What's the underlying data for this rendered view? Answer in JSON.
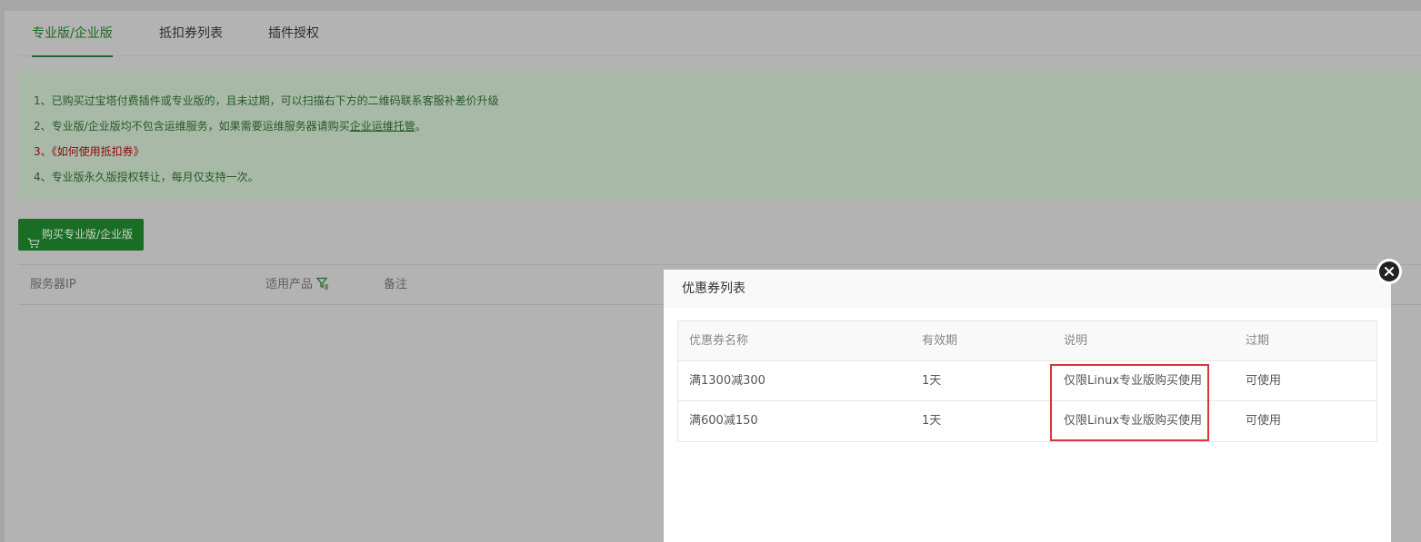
{
  "tabs": [
    {
      "label": "专业版/企业版",
      "active": true
    },
    {
      "label": "抵扣券列表",
      "active": false
    },
    {
      "label": "插件授权",
      "active": false
    }
  ],
  "notice": {
    "line1": "1、已购买过宝塔付费插件或专业版的，且未过期，可以扫描右下方的二维码联系客服补差价升级",
    "line2_prefix": "2、专业版/企业版均不包含运维服务，如果需要运维服务器请购买",
    "line2_link": "企业运维托管",
    "line2_suffix": "。",
    "line3": "3、《如何使用抵扣券》",
    "line4": "4、专业版永久版授权转让，每月仅支持一次。"
  },
  "buy_button": {
    "label": "购买专业版/企业版",
    "icon": "cart-icon"
  },
  "server_table": {
    "headers": [
      "服务器IP",
      "适用产品",
      "备注"
    ],
    "filter_icon": "filter-icon"
  },
  "dialog": {
    "title": "优惠券列表",
    "close_icon": "close-icon",
    "headers": [
      "优惠券名称",
      "有效期",
      "说明",
      "过期"
    ],
    "rows": [
      [
        "满1300减300",
        "1天",
        "仅限Linux专业版购买使用",
        "可使用"
      ],
      [
        "满600减150",
        "1天",
        "仅限Linux专业版购买使用",
        "可使用"
      ]
    ]
  },
  "colors": {
    "accent_green": "#1b6a22",
    "highlight_red": "#d9353a",
    "notice_red": "#8e0b0b"
  }
}
